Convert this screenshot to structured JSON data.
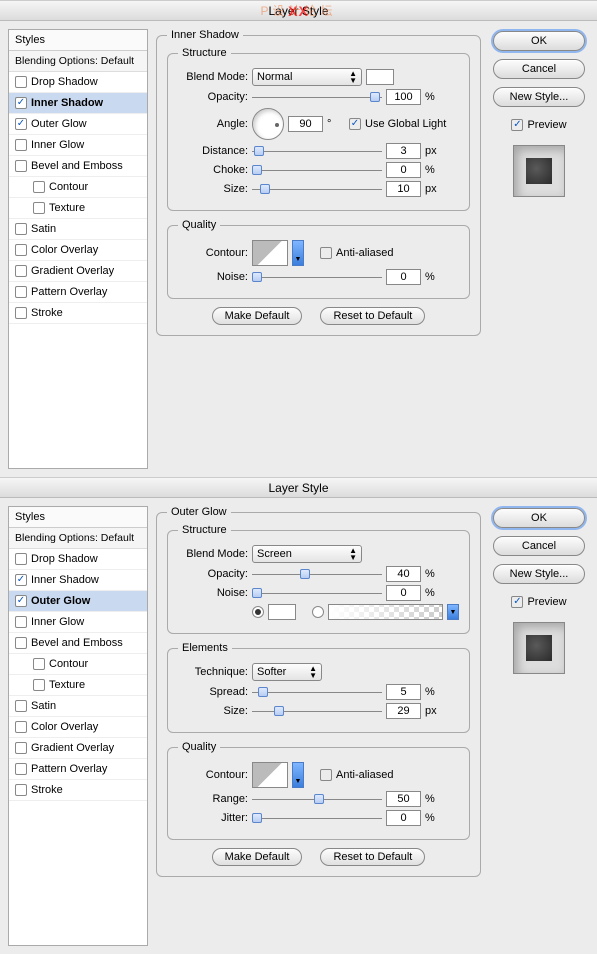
{
  "panel1": {
    "title": "Layer Style",
    "watermark1": "P设计论坛",
    "watermark2": "XX",
    "styles": {
      "header": "Styles",
      "blending": "Blending Options: Default",
      "items": [
        {
          "label": "Drop Shadow",
          "checked": false
        },
        {
          "label": "Inner Shadow",
          "checked": true,
          "selected": true
        },
        {
          "label": "Outer Glow",
          "checked": true
        },
        {
          "label": "Inner Glow",
          "checked": false
        },
        {
          "label": "Bevel and Emboss",
          "checked": false
        },
        {
          "label": "Contour",
          "checked": false,
          "indent": true
        },
        {
          "label": "Texture",
          "checked": false,
          "indent": true
        },
        {
          "label": "Satin",
          "checked": false
        },
        {
          "label": "Color Overlay",
          "checked": false
        },
        {
          "label": "Gradient Overlay",
          "checked": false
        },
        {
          "label": "Pattern Overlay",
          "checked": false
        },
        {
          "label": "Stroke",
          "checked": false
        }
      ]
    },
    "effect": {
      "title": "Inner Shadow",
      "structure": {
        "legend": "Structure",
        "blendModeLabel": "Blend Mode:",
        "blendMode": "Normal",
        "opacityLabel": "Opacity:",
        "opacity": "100",
        "opacityUnit": "%",
        "angleLabel": "Angle:",
        "angle": "90",
        "angleUnit": "°",
        "globalLabel": "Use Global Light",
        "distanceLabel": "Distance:",
        "distance": "3",
        "distanceUnit": "px",
        "chokeLabel": "Choke:",
        "choke": "0",
        "chokeUnit": "%",
        "sizeLabel": "Size:",
        "size": "10",
        "sizeUnit": "px"
      },
      "quality": {
        "legend": "Quality",
        "contourLabel": "Contour:",
        "antiAliasLabel": "Anti-aliased",
        "noiseLabel": "Noise:",
        "noise": "0",
        "noiseUnit": "%"
      },
      "makeDefault": "Make Default",
      "resetDefault": "Reset to Default"
    },
    "buttons": {
      "ok": "OK",
      "cancel": "Cancel",
      "newStyle": "New Style...",
      "preview": "Preview"
    }
  },
  "panel2": {
    "title": "Layer Style",
    "styles": {
      "header": "Styles",
      "blending": "Blending Options: Default",
      "items": [
        {
          "label": "Drop Shadow",
          "checked": false
        },
        {
          "label": "Inner Shadow",
          "checked": true
        },
        {
          "label": "Outer Glow",
          "checked": true,
          "selected": true
        },
        {
          "label": "Inner Glow",
          "checked": false
        },
        {
          "label": "Bevel and Emboss",
          "checked": false
        },
        {
          "label": "Contour",
          "checked": false,
          "indent": true
        },
        {
          "label": "Texture",
          "checked": false,
          "indent": true
        },
        {
          "label": "Satin",
          "checked": false
        },
        {
          "label": "Color Overlay",
          "checked": false
        },
        {
          "label": "Gradient Overlay",
          "checked": false
        },
        {
          "label": "Pattern Overlay",
          "checked": false
        },
        {
          "label": "Stroke",
          "checked": false
        }
      ]
    },
    "effect": {
      "title": "Outer Glow",
      "structure": {
        "legend": "Structure",
        "blendModeLabel": "Blend Mode:",
        "blendMode": "Screen",
        "opacityLabel": "Opacity:",
        "opacity": "40",
        "opacityUnit": "%",
        "noiseLabel": "Noise:",
        "noise": "0",
        "noiseUnit": "%"
      },
      "elements": {
        "legend": "Elements",
        "techniqueLabel": "Technique:",
        "technique": "Softer",
        "spreadLabel": "Spread:",
        "spread": "5",
        "spreadUnit": "%",
        "sizeLabel": "Size:",
        "size": "29",
        "sizeUnit": "px"
      },
      "quality": {
        "legend": "Quality",
        "contourLabel": "Contour:",
        "antiAliasLabel": "Anti-aliased",
        "rangeLabel": "Range:",
        "range": "50",
        "rangeUnit": "%",
        "jitterLabel": "Jitter:",
        "jitter": "0",
        "jitterUnit": "%"
      },
      "makeDefault": "Make Default",
      "resetDefault": "Reset to Default"
    },
    "buttons": {
      "ok": "OK",
      "cancel": "Cancel",
      "newStyle": "New Style...",
      "preview": "Preview"
    }
  }
}
